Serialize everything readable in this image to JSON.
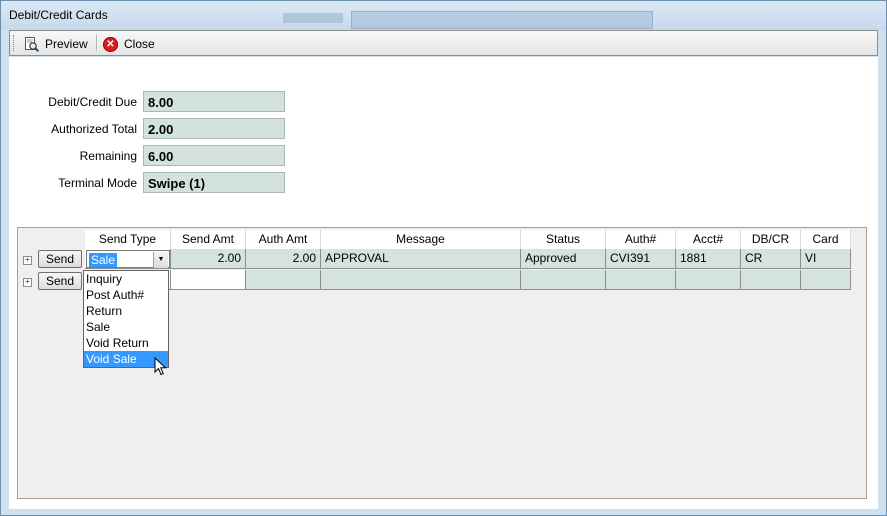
{
  "window": {
    "title": "Debit/Credit Cards"
  },
  "toolbar": {
    "preview_label": "Preview",
    "close_label": "Close"
  },
  "summary": [
    {
      "label": "Debit/Credit Due",
      "value": "8.00"
    },
    {
      "label": "Authorized Total",
      "value": "2.00"
    },
    {
      "label": "Remaining",
      "value": "6.00"
    },
    {
      "label": "Terminal Mode",
      "value": "Swipe (1)"
    }
  ],
  "grid": {
    "columns": [
      "Send Type",
      "Send Amt",
      "Auth Amt",
      "Message",
      "Status",
      "Auth#",
      "Acct#",
      "DB/CR",
      "Card"
    ],
    "send_label": "Send",
    "expander_symbol": "+",
    "rows": [
      {
        "send_type": "Sale",
        "send_amt": "2.00",
        "auth_amt": "2.00",
        "message": "APPROVAL",
        "status": "Approved",
        "auth": "CVI391",
        "acct": "1881",
        "dbcr": "CR",
        "card": "VI"
      },
      {
        "send_type": "",
        "send_amt": "",
        "auth_amt": "",
        "message": "",
        "status": "",
        "auth": "",
        "acct": "",
        "dbcr": "",
        "card": ""
      }
    ]
  },
  "dropdown": {
    "options": [
      "Inquiry",
      "Post Auth#",
      "Return",
      "Sale",
      "Void Return",
      "Void Sale"
    ],
    "highlighted": "Void Sale"
  }
}
